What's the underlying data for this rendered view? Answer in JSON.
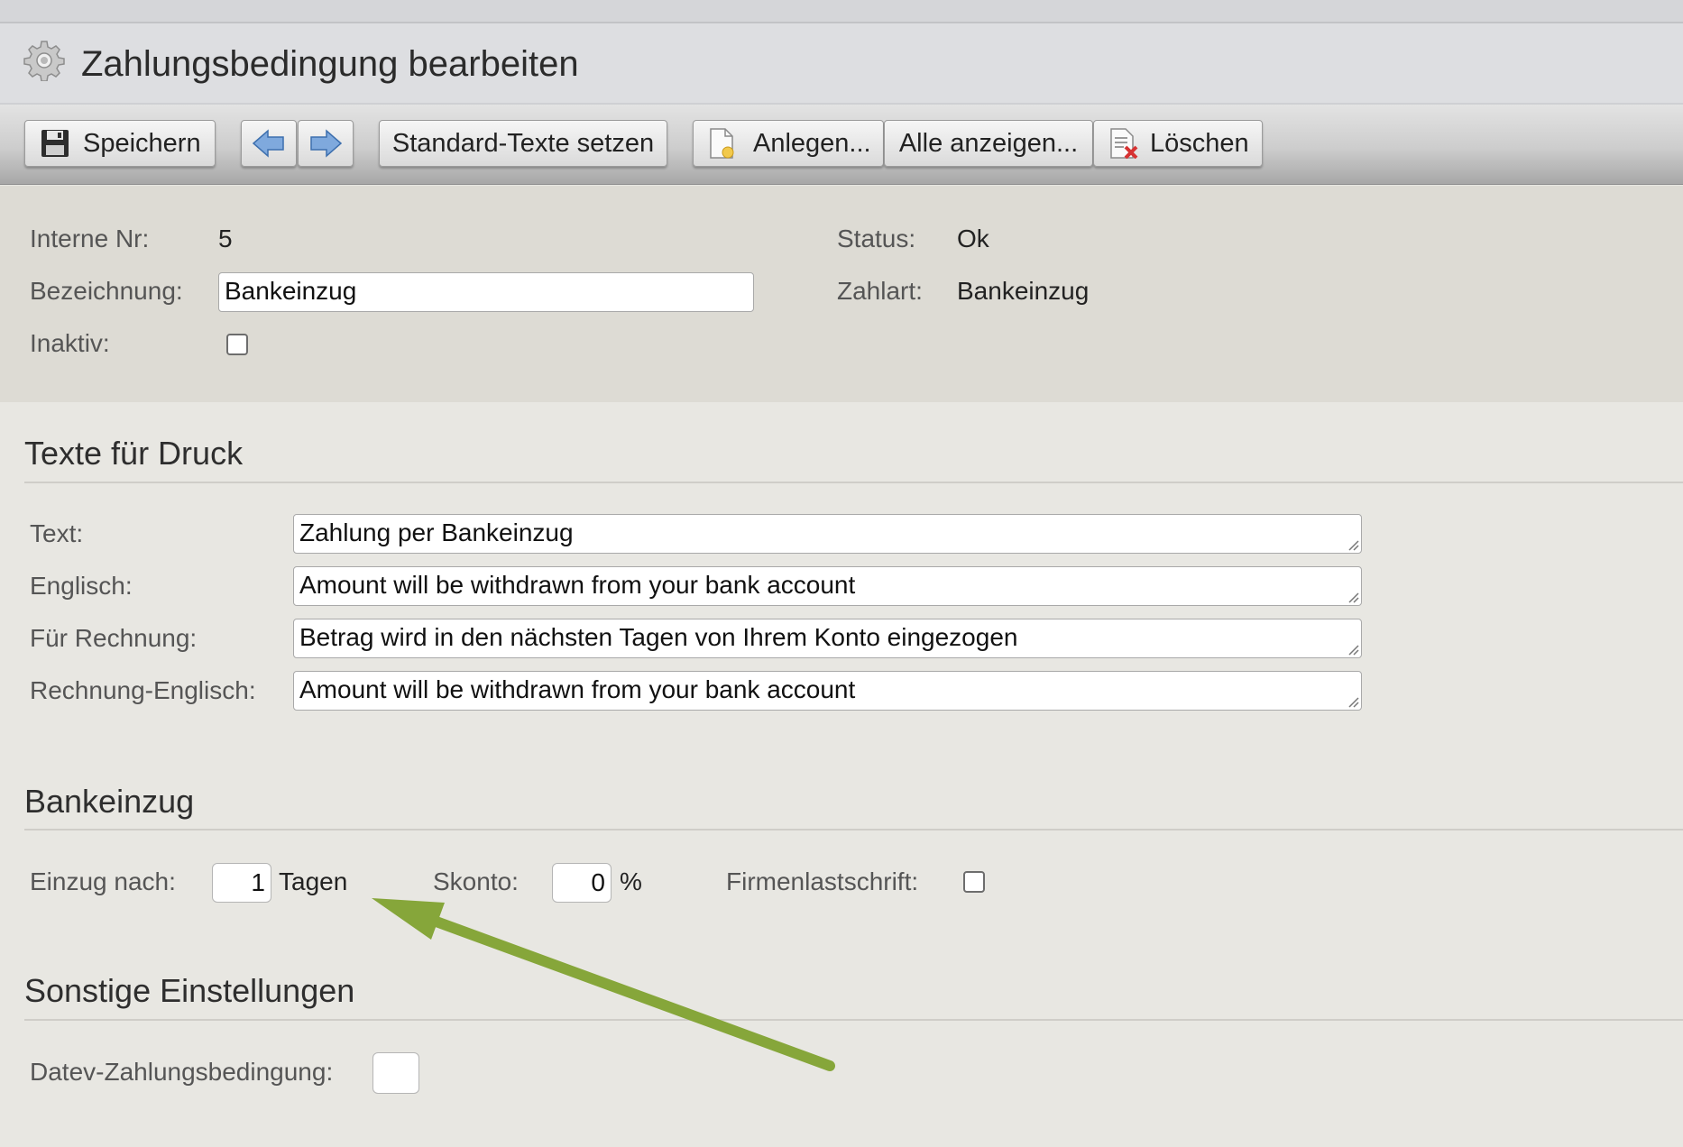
{
  "window": {
    "title": "Zahlungsbedingung bearbeiten",
    "title_icon": "gear-icon"
  },
  "toolbar": {
    "save": {
      "label": "Speichern",
      "icon": "floppy-disk-icon"
    },
    "prev_icon": "arrow-left-icon",
    "next_icon": "arrow-right-icon",
    "set_default_texts": {
      "label": "Standard-Texte setzen"
    },
    "create": {
      "label": "Anlegen...",
      "icon": "new-document-icon"
    },
    "show_all": {
      "label": "Alle anzeigen..."
    },
    "delete": {
      "label": "Löschen",
      "icon": "delete-document-icon"
    }
  },
  "header": {
    "internal_no": {
      "label": "Interne Nr:",
      "value": "5"
    },
    "name": {
      "label": "Bezeichnung:",
      "value": "Bankeinzug"
    },
    "inactive": {
      "label": "Inaktiv:",
      "checked": false
    },
    "status": {
      "label": "Status:",
      "value": "Ok"
    },
    "payment_type": {
      "label": "Zahlart:",
      "value": "Bankeinzug"
    }
  },
  "print_texts": {
    "heading": "Texte für Druck",
    "text": {
      "label": "Text:",
      "value": "Zahlung per Bankeinzug"
    },
    "english": {
      "label": "Englisch:",
      "value": "Amount will be withdrawn from your bank account"
    },
    "invoice": {
      "label": "Für Rechnung:",
      "value": "Betrag wird in den nächsten Tagen von Ihrem Konto eingezogen"
    },
    "invoice_english": {
      "label": "Rechnung-Englisch:",
      "value": "Amount will be withdrawn from your bank account"
    }
  },
  "direct_debit": {
    "heading": "Bankeinzug",
    "collect_after": {
      "label": "Einzug nach:",
      "value": "1",
      "unit": "Tagen"
    },
    "discount": {
      "label": "Skonto:",
      "value": "0",
      "unit": "%"
    },
    "business_debit": {
      "label": "Firmenlastschrift:",
      "checked": false
    }
  },
  "other_settings": {
    "heading": "Sonstige Einstellungen",
    "datev": {
      "label": "Datev-Zahlungsbedingung:",
      "value": ""
    }
  },
  "annotation": {
    "color": "#86a63a"
  }
}
